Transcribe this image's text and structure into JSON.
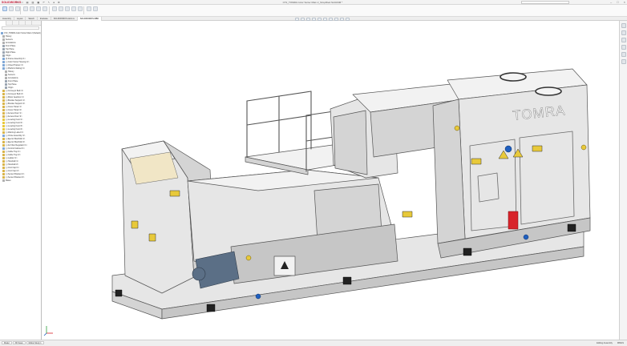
{
  "app": {
    "logo": "SOLIDWORKS",
    "window_title": "CT2_TOMRA Color Sorter Main 2_Simplified.SLDASM *"
  },
  "tabs": [
    {
      "label": "Assembly",
      "active": false
    },
    {
      "label": "Layout",
      "active": false
    },
    {
      "label": "Sketch",
      "active": false
    },
    {
      "label": "Evaluate",
      "active": false
    },
    {
      "label": "SOLIDWORKS Add-Ins",
      "active": false
    },
    {
      "label": "SOLIDWORKS MBD",
      "active": true
    }
  ],
  "feature_tree": {
    "items": [
      {
        "label": "CT2_TOMRA Color Sorter Main 2 (Default)",
        "icon": "asm"
      },
      {
        "label": "History",
        "icon": "mate"
      },
      {
        "label": "Sensors",
        "icon": "mate"
      },
      {
        "label": "Annotations",
        "icon": "mate"
      },
      {
        "label": "Front Plane",
        "icon": "plane"
      },
      {
        "label": "Top Plane",
        "icon": "plane"
      },
      {
        "label": "Right Plane",
        "icon": "plane"
      },
      {
        "label": "Origin",
        "icon": "plane"
      },
      {
        "label": "(f) Frame Assembly<1>",
        "icon": "asm"
      },
      {
        "label": "(-) Color Sorter Housing<1>",
        "icon": "asm"
      },
      {
        "label": "(-) Infeed Hopper<1>",
        "icon": "asm"
      },
      {
        "label": "(-) Platform Railing<1>",
        "icon": "asm"
      },
      {
        "label": "History",
        "icon": "mate"
      },
      {
        "label": "Sensors",
        "icon": "mate"
      },
      {
        "label": "Annotations",
        "icon": "mate"
      },
      {
        "label": "Front Plane",
        "icon": "plane"
      },
      {
        "label": "Top Plane",
        "icon": "plane"
      },
      {
        "label": "Origin",
        "icon": "plane"
      },
      {
        "label": "(-) Conveyor Belt<1>",
        "icon": "part"
      },
      {
        "label": "(-) Conveyor Belt<2>",
        "icon": "part"
      },
      {
        "label": "(-) Motor Gearbox<1>",
        "icon": "part"
      },
      {
        "label": "(-) Bracket Support<1>",
        "icon": "part"
      },
      {
        "label": "(-) Bracket Support<2>",
        "icon": "part"
      },
      {
        "label": "(-) Cover Panel<1>",
        "icon": "part"
      },
      {
        "label": "(-) Cover Panel<2>",
        "icon": "part"
      },
      {
        "label": "(-) Access Door<1>",
        "icon": "part"
      },
      {
        "label": "(-) Access Door<2>",
        "icon": "part"
      },
      {
        "label": "(-) Leveling Foot<1>",
        "icon": "yellow"
      },
      {
        "label": "(-) Leveling Foot<2>",
        "icon": "yellow"
      },
      {
        "label": "(-) Leveling Foot<3>",
        "icon": "yellow"
      },
      {
        "label": "(-) Leveling Foot<4>",
        "icon": "yellow"
      },
      {
        "label": "(-) Warning Label<1>",
        "icon": "part"
      },
      {
        "label": "(-) Chute Assembly<1>",
        "icon": "asm"
      },
      {
        "label": "(-) Ejector Manifold<1>",
        "icon": "part"
      },
      {
        "label": "(-) Ejector Manifold<2>",
        "icon": "part"
      },
      {
        "label": "(-) Air Filter Regulator<1>",
        "icon": "part"
      },
      {
        "label": "(-) Control Cabinet<1>",
        "icon": "asm"
      },
      {
        "label": "(-) Cable Tray<1>",
        "icon": "part"
      },
      {
        "label": "(-) Cable Tray<2>",
        "icon": "part"
      },
      {
        "label": "(-) Ladder<1>",
        "icon": "part"
      },
      {
        "label": "(-) Handrail<1>",
        "icon": "part"
      },
      {
        "label": "(-) Handrail<2>",
        "icon": "part"
      },
      {
        "label": "(-) Vent Cap<1>",
        "icon": "part"
      },
      {
        "label": "(-) Vent Cap<2>",
        "icon": "part"
      },
      {
        "label": "(-) Sensor Bracket<1>",
        "icon": "part"
      },
      {
        "label": "(-) Sensor Bracket<2>",
        "icon": "part"
      },
      {
        "label": "Mates",
        "icon": "mate"
      }
    ]
  },
  "model": {
    "brand_label": "TOMRA",
    "colors": {
      "body": "#e6e6e6",
      "body_shade": "#cfcfcf",
      "outline": "#555555",
      "label_yellow": "#e8c93a",
      "accent_red": "#d8232a",
      "accent_blue": "#1f5fbf",
      "motor_blue": "#5b6f86",
      "foot": "#222222"
    }
  },
  "bottom_tabs": [
    "Model",
    "3D Views",
    "Motion Study 1"
  ],
  "status": {
    "left": "SOLIDWORKS Premium 2019 SP3.0",
    "units": "MMGS",
    "state": "Editing Assembly"
  }
}
